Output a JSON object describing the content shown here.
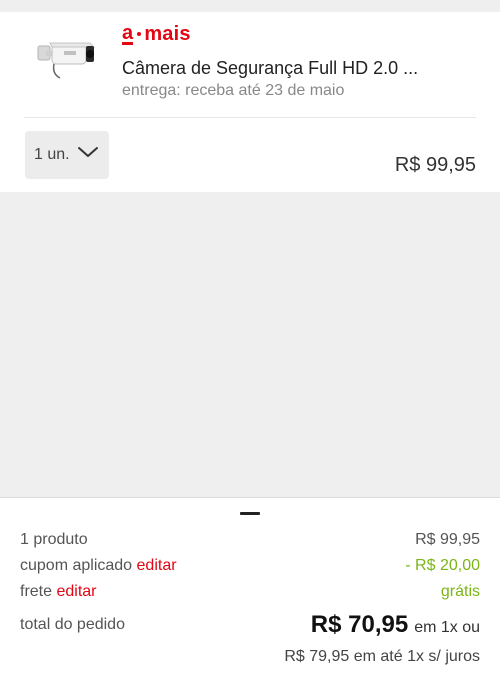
{
  "brand": {
    "name": "a·mais"
  },
  "product": {
    "name": "Câmera de Segurança Full HD 2.0 ...",
    "delivery": "entrega: receba até 23 de maio",
    "image_icon": "security-camera-icon",
    "quantity_label": "1 un.",
    "price": "R$ 99,95"
  },
  "summary": {
    "products_label": "1 produto",
    "products_value": "R$ 99,95",
    "coupon_label": "cupom aplicado",
    "coupon_edit": "editar",
    "coupon_value": "- R$ 20,00",
    "shipping_label": "frete",
    "shipping_edit": "editar",
    "shipping_value": "grátis",
    "total_label": "total do pedido",
    "total_value": "R$ 70,95",
    "total_suffix": "em 1x ou",
    "installments": "R$ 79,95 em até 1x s/ juros"
  },
  "colors": {
    "accent": "#e30613",
    "discount": "#7cb518",
    "background": "#efefef"
  }
}
